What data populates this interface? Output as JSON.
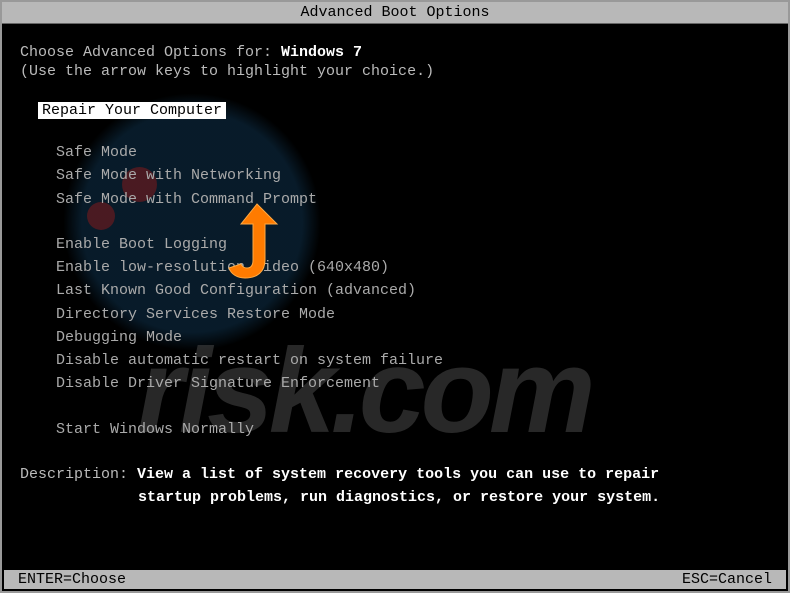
{
  "title": "Advanced Boot Options",
  "prompt_prefix": "Choose Advanced Options for: ",
  "os_name": "Windows 7",
  "instruction": "(Use the arrow keys to highlight your choice.)",
  "selected_option": "Repair Your Computer",
  "group1": {
    "opt1": "Safe Mode",
    "opt2": "Safe Mode with Networking",
    "opt3": "Safe Mode with Command Prompt"
  },
  "group2": {
    "opt1": "Enable Boot Logging",
    "opt2": "Enable low-resolution video (640x480)",
    "opt3": "Last Known Good Configuration (advanced)",
    "opt4": "Directory Services Restore Mode",
    "opt5": "Debugging Mode",
    "opt6": "Disable automatic restart on system failure",
    "opt7": "Disable Driver Signature Enforcement"
  },
  "group3": {
    "opt1": "Start Windows Normally"
  },
  "description_label": "Description: ",
  "description_line1": "View a list of system recovery tools you can use to repair",
  "description_line2": "startup problems, run diagnostics, or restore your system.",
  "footer": {
    "left": "ENTER=Choose",
    "right": "ESC=Cancel"
  }
}
